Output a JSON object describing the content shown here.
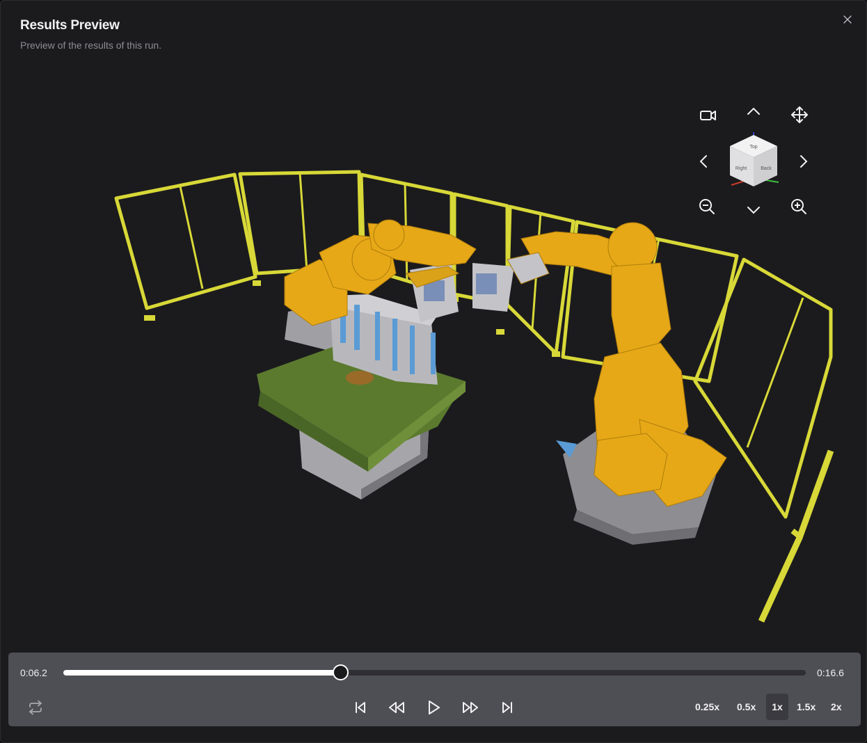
{
  "dialog": {
    "title": "Results Preview",
    "subtitle": "Preview of the results of this run."
  },
  "viewer": {
    "cube_faces": [
      "Right",
      "Back",
      "Top"
    ],
    "controls": [
      "camera-icon",
      "pan-up-icon",
      "move-icon",
      "rotate-left-icon",
      "rotate-right-icon",
      "zoom-out-icon",
      "pan-down-icon",
      "zoom-in-icon"
    ]
  },
  "playback": {
    "current_time": "0:06.2",
    "total_time": "0:16.6",
    "progress": 0.373,
    "speeds": [
      "0.25x",
      "0.5x",
      "1x",
      "1.5x",
      "2x"
    ],
    "active_speed": "1x"
  },
  "colors": {
    "fence": "#d8d838",
    "robot": "#e6a817",
    "table_top": "#5b7a2e",
    "base": "#8a8a8e",
    "fixture": "#5a9bd5",
    "accent_active": "#3a3a40"
  }
}
